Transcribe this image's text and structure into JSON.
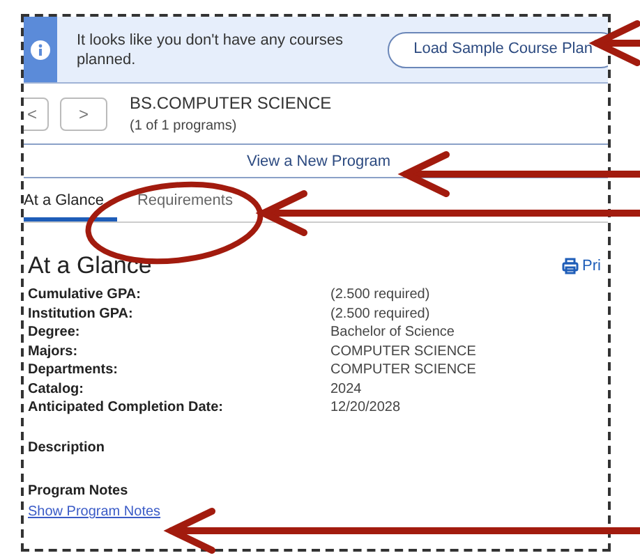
{
  "banner": {
    "message": "It looks like you don't have any courses planned.",
    "button": "Load Sample Course Plan"
  },
  "program": {
    "prev": "<",
    "next": ">",
    "title": "BS.COMPUTER SCIENCE",
    "count": "(1 of 1 programs)",
    "link": "View a New Program"
  },
  "tabs": [
    {
      "label": "At a Glance",
      "selected": true
    },
    {
      "label": "Requirements",
      "selected": false
    }
  ],
  "section": {
    "title": "At a Glance",
    "print": "Pri"
  },
  "fields": [
    {
      "label": "Cumulative GPA:",
      "value": "(2.500 required)"
    },
    {
      "label": "Institution GPA:",
      "value": "(2.500 required)"
    },
    {
      "label": "Degree:",
      "value": "Bachelor of Science"
    },
    {
      "label": "Majors:",
      "value": "COMPUTER SCIENCE"
    },
    {
      "label": "Departments:",
      "value": "COMPUTER SCIENCE"
    },
    {
      "label": "Catalog:",
      "value": "2024"
    },
    {
      "label": "Anticipated Completion Date:",
      "value": "12/20/2028"
    }
  ],
  "description": {
    "title": "Description"
  },
  "notes": {
    "title": "Program Notes",
    "link": "Show Program Notes"
  }
}
